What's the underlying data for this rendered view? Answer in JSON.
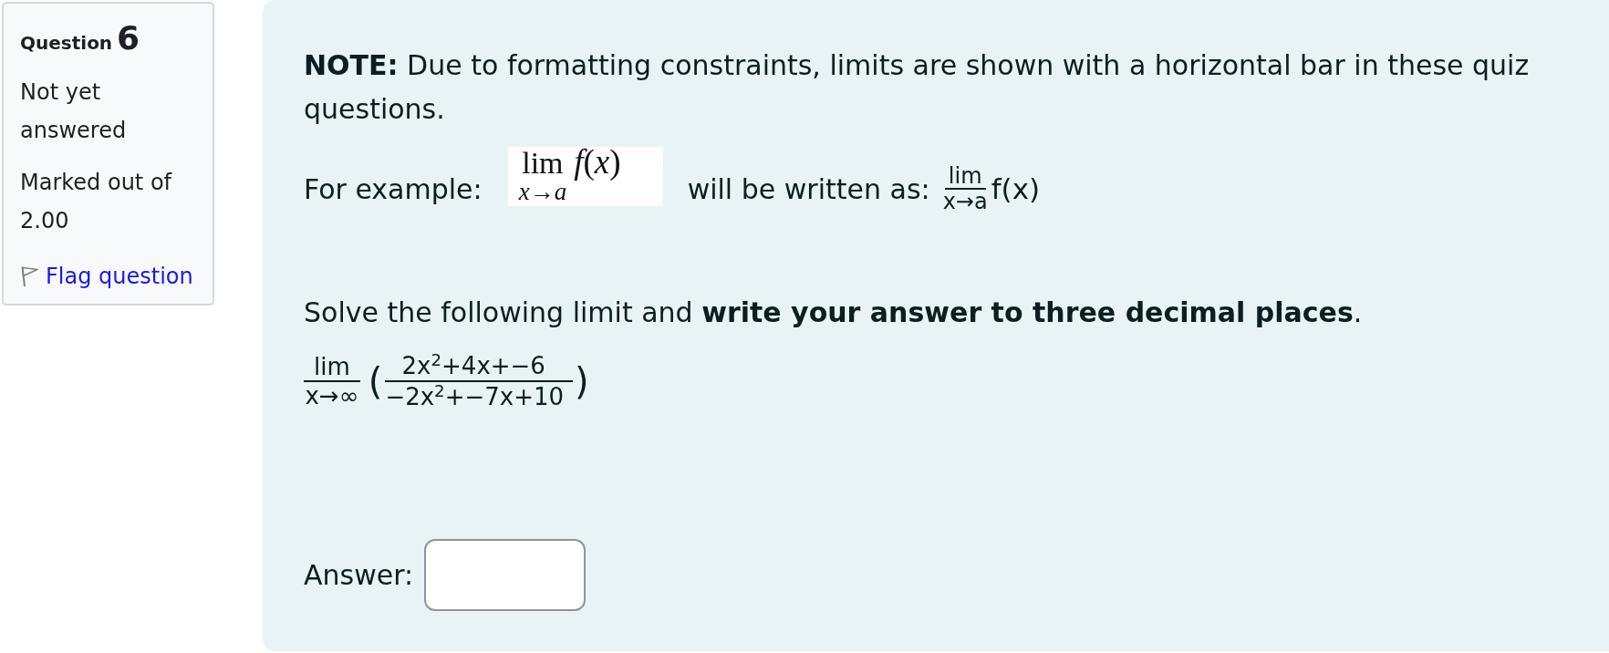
{
  "question_info": {
    "title": "Question",
    "number": "6",
    "status": "Not yet answered",
    "marks": "Marked out of 2.00",
    "flag": {
      "label": "Flag question",
      "flagged": false
    }
  },
  "question": {
    "note": "**NOTE:** Due to formatting constraints, limits are shown with a horizontal bar in these quiz questions.",
    "example": {
      "lead": "For example:",
      "image": {
        "operator": "lim",
        "subscript": "*x*→*a*",
        "function": "*f*(*x*)"
      },
      "middle": "will be written as:",
      "written": {
        "operator": "lim",
        "subscript": "x→a",
        "function": "f(x)"
      }
    },
    "instruction": "Solve the following limit and **write your answer to three decimal places**.",
    "expression": {
      "operator": "lim",
      "subscript": "x→∞",
      "open": "(",
      "numerator": "2x$^{2}$+4x+−6",
      "denominator": "−2x$^{2}$+−7x+10",
      "close": ")"
    },
    "answer": {
      "label": "Answer:"
    }
  }
}
